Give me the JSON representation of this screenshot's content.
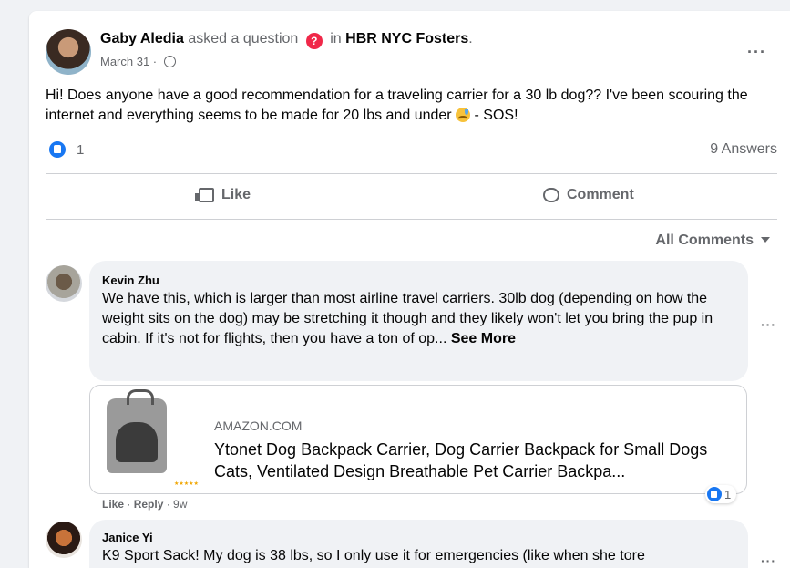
{
  "post": {
    "author": "Gaby Aledia",
    "action_text": "asked a question",
    "in_text": "in",
    "group": "HBR NYC Fosters",
    "date": "March 31 ·",
    "text_before_emoji": "Hi! Does anyone have a good recommendation for a traveling carrier for a 30 lb dog?? I've been scouring the internet and everything seems to be made for 20 lbs and under",
    "text_after_emoji": "- SOS!",
    "reaction_count": "1",
    "answers": "9 Answers",
    "like_label": "Like",
    "comment_label": "Comment",
    "all_comments_label": "All Comments"
  },
  "comments": [
    {
      "author": "Kevin Zhu",
      "text": "We have this, which is larger than most airline travel carriers. 30lb dog (depending on how the weight sits on the dog) may be stretching it though and they likely won't let you bring the pup in cabin. If it's not for flights, then you have a ton of op... ",
      "see_more": "See More",
      "link": {
        "domain": "AMAZON.COM",
        "title": "Ytonet Dog Backpack Carrier, Dog Carrier Backpack for Small Dogs Cats, Ventilated Design Breathable Pet Carrier Backpa..."
      },
      "like_action": "Like",
      "reply_action": "Reply",
      "age": "9w",
      "reaction_count": "1"
    },
    {
      "author": "Janice Yi",
      "text": "K9 Sport Sack! My dog is 38 lbs, so I only use it for emergencies (like when she tore"
    }
  ],
  "colors": {
    "accent": "#1877f2",
    "question_badge": "#f02849",
    "muted_text": "#65676b",
    "bubble_bg": "#f0f2f5"
  }
}
